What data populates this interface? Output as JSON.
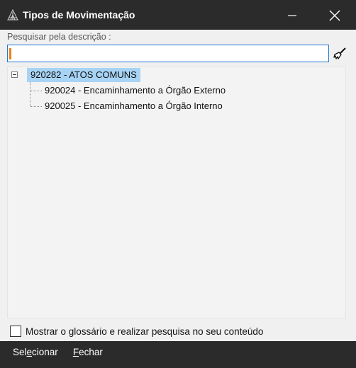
{
  "window": {
    "title": "Tipos de Movimentação",
    "accent_color": "#1e78d7",
    "selection_color": "#a7d3f5"
  },
  "title_controls": {
    "minimize_icon": "minimize-icon",
    "close_icon": "close-icon"
  },
  "search": {
    "label": "Pesquisar pela descrição :",
    "value": "",
    "clear_icon": "brush-icon"
  },
  "tree": {
    "root": {
      "label": "920282 - ATOS COMUNS",
      "expanded": true,
      "selected": true,
      "children": [
        {
          "label": "920024 - Encaminhamento a Órgão Externo"
        },
        {
          "label": "920025 - Encaminhamento a Órgão Interno"
        }
      ]
    }
  },
  "glossary": {
    "label": "Mostrar o glossário e realizar pesquisa no seu conteúdo",
    "checked": false
  },
  "footer": {
    "select": {
      "accel": "e",
      "rest_before": "Sel",
      "rest_after": "cionar"
    },
    "close": {
      "accel": "F",
      "rest_after": "echar"
    }
  }
}
